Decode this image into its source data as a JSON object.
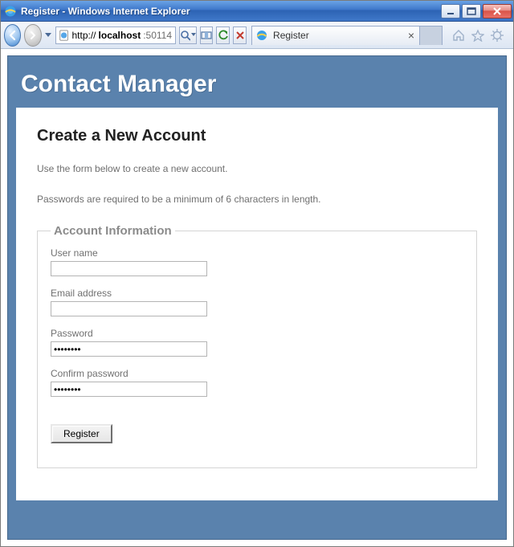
{
  "window": {
    "title": "Register - Windows Internet Explorer"
  },
  "address": {
    "scheme": "http://",
    "host_bold": "localhost",
    "port": ":50114"
  },
  "tab": {
    "label": "Register"
  },
  "page": {
    "brand": "Contact Manager",
    "heading": "Create a New Account",
    "intro1": "Use the form below to create a new account.",
    "intro2": "Passwords are required to be a minimum of 6 characters in length.",
    "legend": "Account Information",
    "fields": {
      "username": {
        "label": "User name",
        "value": ""
      },
      "email": {
        "label": "Email address",
        "value": ""
      },
      "password": {
        "label": "Password",
        "value": "••••••••"
      },
      "confirm": {
        "label": "Confirm password",
        "value": "••••••••"
      }
    },
    "submit": "Register"
  }
}
